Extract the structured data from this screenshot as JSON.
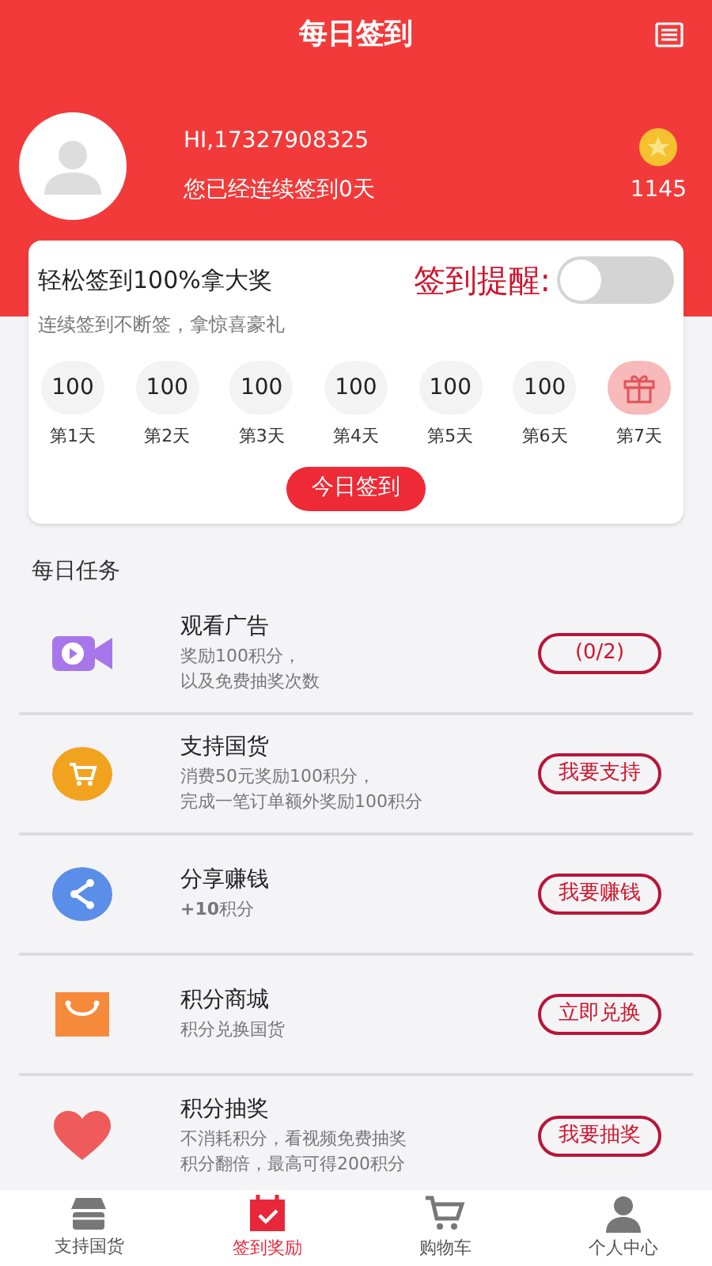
{
  "header": {
    "title": "每日签到"
  },
  "user": {
    "greeting": "HI,17327908325",
    "streak": "您已经连续签到0天",
    "points": "1145"
  },
  "signin_card": {
    "title": "轻松签到100%拿大奖",
    "subtitle": "连续签到不断签，拿惊喜豪礼",
    "reminder_label": "签到提醒:",
    "reminder_on": false,
    "days": [
      {
        "kind": "points",
        "value": "100",
        "label": "第1天"
      },
      {
        "kind": "points",
        "value": "100",
        "label": "第2天"
      },
      {
        "kind": "points",
        "value": "100",
        "label": "第3天"
      },
      {
        "kind": "points",
        "value": "100",
        "label": "第4天"
      },
      {
        "kind": "points",
        "value": "100",
        "label": "第5天"
      },
      {
        "kind": "points",
        "value": "100",
        "label": "第6天"
      },
      {
        "kind": "gift",
        "label": "第7天"
      }
    ],
    "button": "今日签到"
  },
  "tasks_heading": "每日任务",
  "tasks": [
    {
      "kind": "video",
      "title": "观看广告",
      "lines": [
        "奖励100积分，",
        "以及免费抽奖次数"
      ],
      "button": "(0/2)"
    },
    {
      "kind": "cart",
      "title": "支持国货",
      "lines": [
        "消费50元奖励100积分，",
        "完成一笔订单额外奖励100积分"
      ],
      "button": "我要支持"
    },
    {
      "kind": "share",
      "title": "分享赚钱",
      "lines": [
        "**+10**积分"
      ],
      "button": "我要赚钱"
    },
    {
      "kind": "bag",
      "title": "积分商城",
      "lines": [
        "积分兑换国货"
      ],
      "button": "立即兑换"
    },
    {
      "kind": "heart",
      "title": "积分抽奖",
      "lines": [
        "不消耗积分，看视频免费抽奖",
        "积分翻倍，最高可得200积分"
      ],
      "button": "我要抽奖"
    }
  ],
  "tabs": [
    {
      "kind": "store",
      "label": "支持国货",
      "selected": false
    },
    {
      "kind": "calendar",
      "label": "签到奖励",
      "selected": true
    },
    {
      "kind": "cart",
      "label": "购物车",
      "selected": false
    },
    {
      "kind": "person",
      "label": "个人中心",
      "selected": false
    }
  ]
}
